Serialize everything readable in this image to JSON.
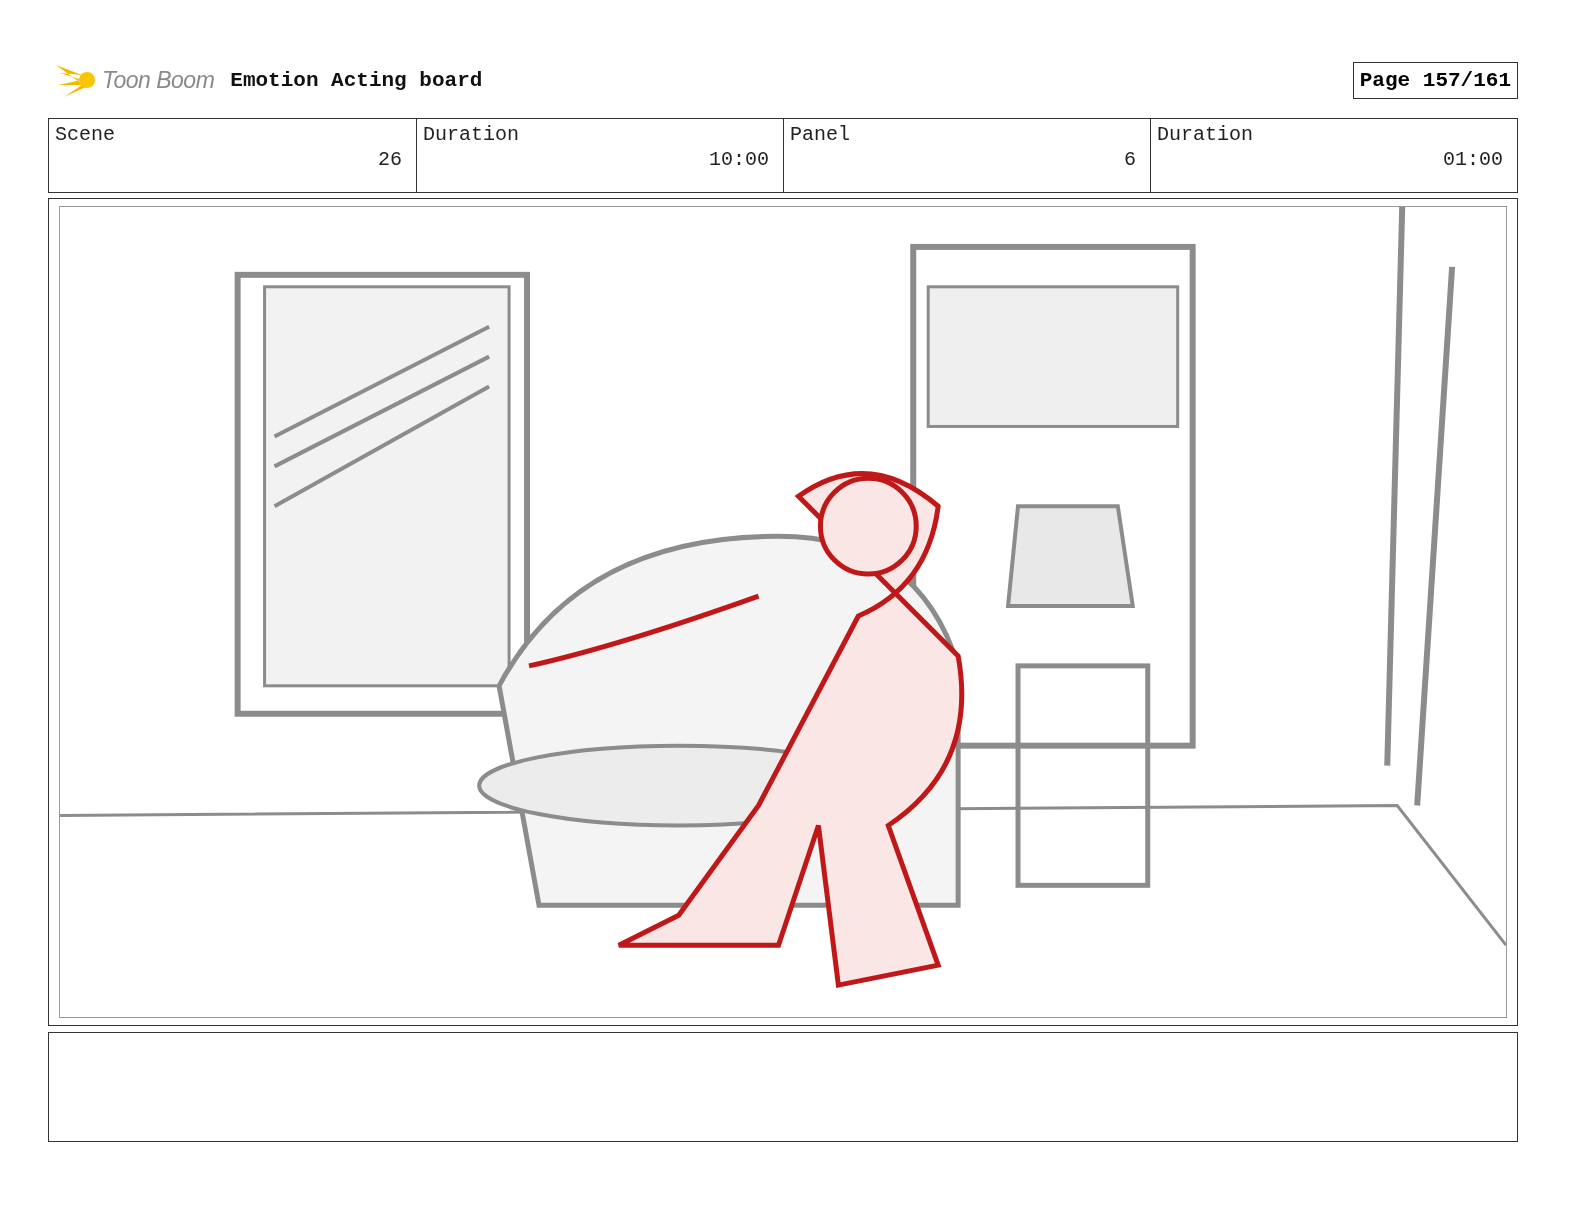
{
  "header": {
    "logo": "Toon Boom",
    "title": "Emotion Acting board",
    "page": "Page 157/161"
  },
  "info": [
    {
      "label": "Scene",
      "value": "26"
    },
    {
      "label": "Duration",
      "value": "10:00"
    },
    {
      "label": "Panel",
      "value": "6"
    },
    {
      "label": "Duration",
      "value": "01:00"
    }
  ]
}
